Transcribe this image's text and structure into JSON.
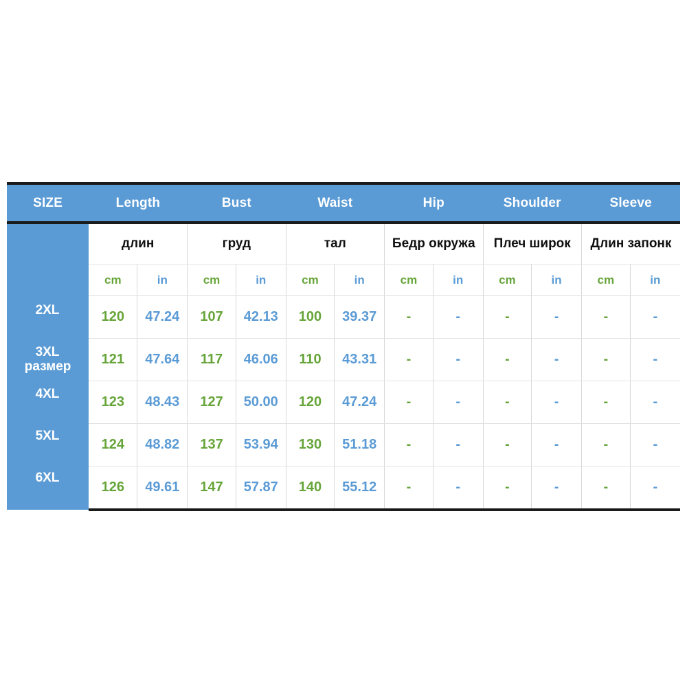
{
  "table": {
    "title_row": {
      "size_label": "SIZE",
      "measures": [
        "Length",
        "Bust",
        "Waist",
        "Hip",
        "Shoulder",
        "Sleeve"
      ]
    },
    "ru_row": {
      "size_label": "размер",
      "measures": [
        "длин",
        "груд",
        "тал",
        "Бедр окружа",
        "Плеч широк",
        "Длин запонк"
      ]
    },
    "unit_row": {
      "cm": "cm",
      "in": "in",
      "units": [
        "cm",
        "in",
        "cm",
        "in",
        "cm",
        "in",
        "cm",
        "in",
        "cm",
        "in",
        "cm",
        "in"
      ]
    },
    "empty_value": "-",
    "rows": [
      {
        "size": "2XL",
        "cells": [
          "120",
          "47.24",
          "107",
          "42.13",
          "100",
          "39.37",
          "-",
          "-",
          "-",
          "-",
          "-",
          "-"
        ]
      },
      {
        "size": "3XL",
        "cells": [
          "121",
          "47.64",
          "117",
          "46.06",
          "110",
          "43.31",
          "-",
          "-",
          "-",
          "-",
          "-",
          "-"
        ]
      },
      {
        "size": "4XL",
        "cells": [
          "123",
          "48.43",
          "127",
          "50.00",
          "120",
          "47.24",
          "-",
          "-",
          "-",
          "-",
          "-",
          "-"
        ]
      },
      {
        "size": "5XL",
        "cells": [
          "124",
          "48.82",
          "137",
          "53.94",
          "130",
          "51.18",
          "-",
          "-",
          "-",
          "-",
          "-",
          "-"
        ]
      },
      {
        "size": "6XL",
        "cells": [
          "126",
          "49.61",
          "147",
          "57.87",
          "140",
          "55.12",
          "-",
          "-",
          "-",
          "-",
          "-",
          "-"
        ]
      }
    ]
  },
  "colors": {
    "header_blue": "#5B9BD5",
    "cm_green": "#67A53A",
    "in_blue": "#5B9BD5",
    "border_dark": "#1a1a1a",
    "grid_line": "#d8d8d8",
    "background": "#ffffff"
  }
}
